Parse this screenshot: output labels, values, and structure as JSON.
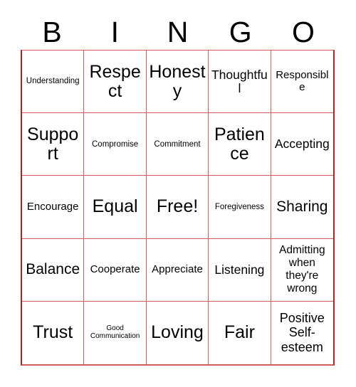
{
  "card": {
    "title": "BINGO",
    "header_letters": [
      "B",
      "I",
      "N",
      "G",
      "O"
    ],
    "grid_border_color": "#cd5c5c",
    "grid_outer_color": "#b22222",
    "text_color": "#000000",
    "background_color": "#ffffff",
    "rows": 5,
    "columns": 5,
    "free_space": {
      "label": "Free!",
      "row": 3,
      "column": 3
    },
    "cells": [
      [
        {
          "label": "Understanding",
          "size": "xs"
        },
        {
          "label": "Respect",
          "size": "xl"
        },
        {
          "label": "Honesty",
          "size": "xl"
        },
        {
          "label": "Thoughtful",
          "size": "md"
        },
        {
          "label": "Responsible",
          "size": "sm"
        }
      ],
      [
        {
          "label": "Support",
          "size": "xl"
        },
        {
          "label": "Compromise",
          "size": "xs"
        },
        {
          "label": "Commitment",
          "size": "xs"
        },
        {
          "label": "Patience",
          "size": "xl"
        },
        {
          "label": "Accepting",
          "size": "md"
        }
      ],
      [
        {
          "label": "Encourage",
          "size": "sm"
        },
        {
          "label": "Equal",
          "size": "xl"
        },
        {
          "label": "Free!",
          "size": "xl"
        },
        {
          "label": "Foregiveness",
          "size": "xs"
        },
        {
          "label": "Sharing",
          "size": "lg"
        }
      ],
      [
        {
          "label": "Balance",
          "size": "lg"
        },
        {
          "label": "Cooperate",
          "size": "sm"
        },
        {
          "label": "Appreciate",
          "size": "sm"
        },
        {
          "label": "Listening",
          "size": "md"
        },
        {
          "label": "Admitting when they're wrong",
          "size": "multi"
        }
      ],
      [
        {
          "label": "Trust",
          "size": "xl"
        },
        {
          "label": "Good Communication",
          "size": "xxs"
        },
        {
          "label": "Loving",
          "size": "xl"
        },
        {
          "label": "Fair",
          "size": "xl"
        },
        {
          "label": "Positive Self-esteem",
          "size": "multi3"
        }
      ]
    ]
  }
}
